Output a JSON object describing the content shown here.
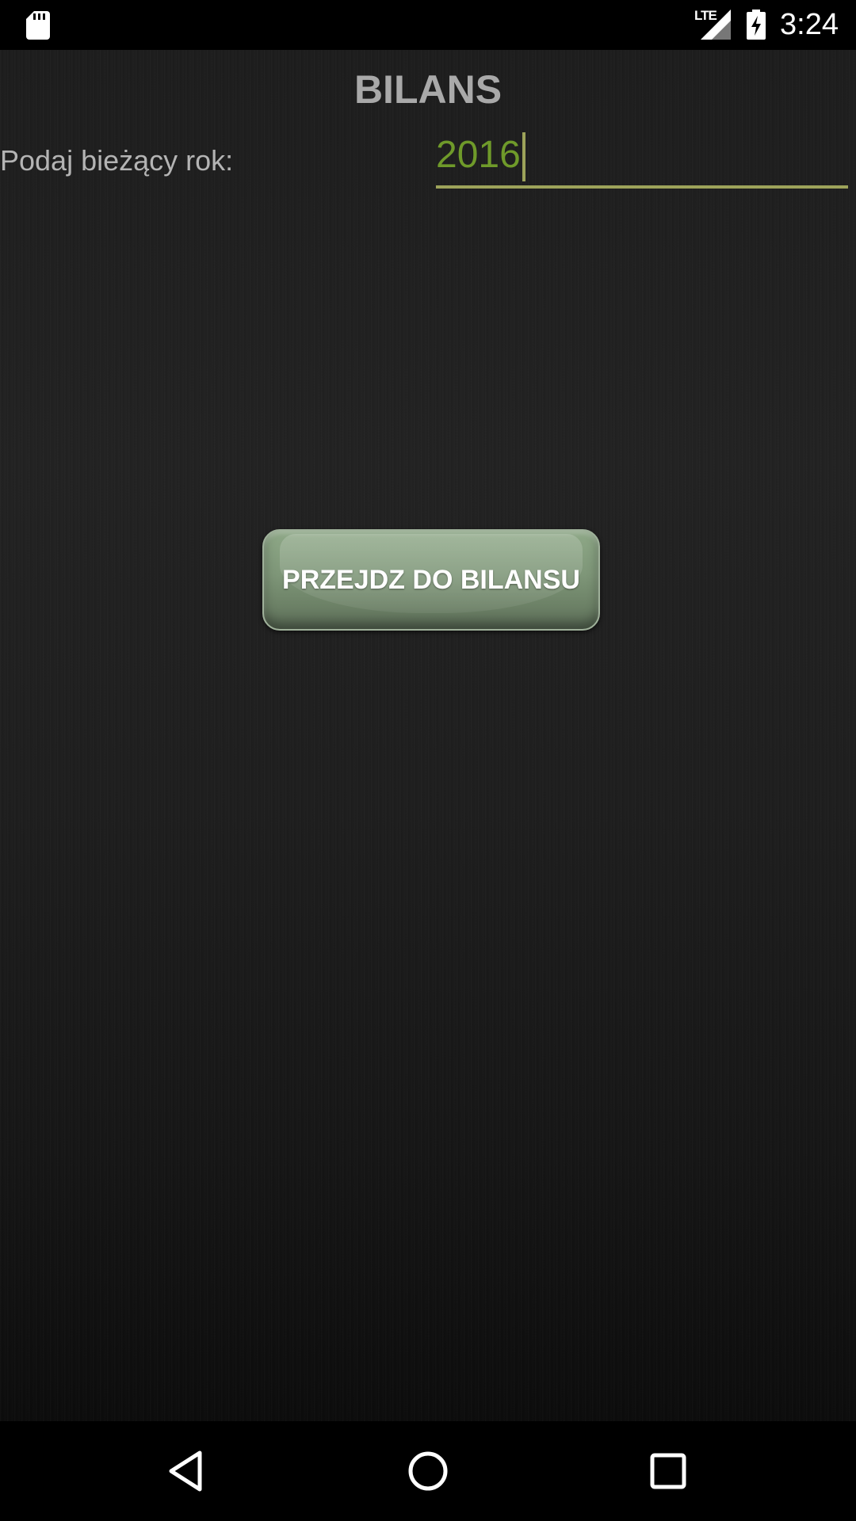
{
  "status_bar": {
    "time": "3:24",
    "network_label": "LTE",
    "icons": [
      "sd-card-icon",
      "lte-signal-icon",
      "battery-charging-icon"
    ]
  },
  "app": {
    "title": "BILANS",
    "year_label": "Podaj bieżący rok:",
    "year_value": "2016",
    "go_button_label": "PRZEJDZ DO BILANSU"
  },
  "nav_bar": {
    "icons": [
      "back-icon",
      "home-icon",
      "recents-icon"
    ]
  },
  "colors": {
    "title": "#a9a9a9",
    "label": "#b4b4b4",
    "input_text": "#6f9a2a",
    "input_underline": "#9da35a",
    "button": "#7e9678"
  }
}
